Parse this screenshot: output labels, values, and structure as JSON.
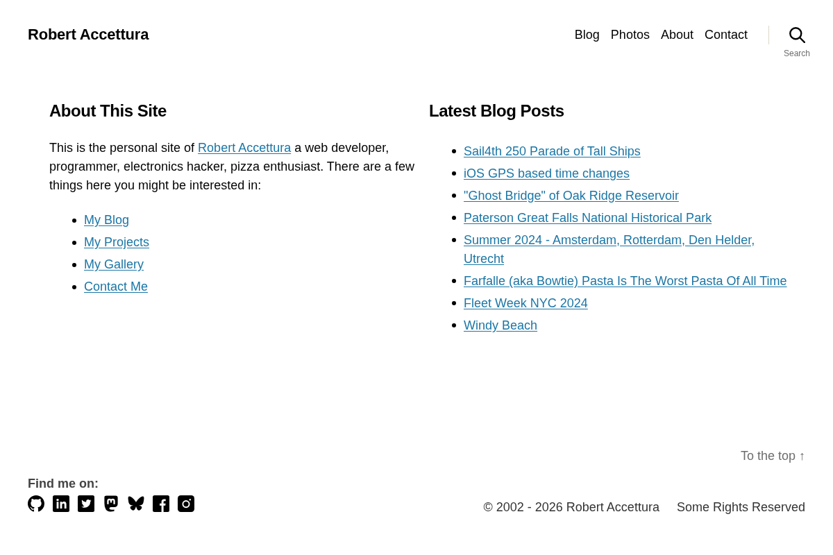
{
  "header": {
    "site_title": "Robert Accettura",
    "nav": [
      "Blog",
      "Photos",
      "About",
      "Contact"
    ],
    "search_label": "Search"
  },
  "about": {
    "heading": "About This Site",
    "intro": [
      {
        "kind": "text",
        "text": "This is the personal site of "
      },
      {
        "kind": "link",
        "text": "Robert Accettura"
      },
      {
        "kind": "text",
        "text": " a web developer, programmer, electronics hacker, pizza enthusiast. There are a few things here you might be interested in:"
      }
    ],
    "links": [
      "My Blog",
      "My Projects",
      "My Gallery",
      "Contact Me"
    ]
  },
  "latest_posts": {
    "heading": "Latest Blog Posts",
    "posts": [
      "Sail4th 250 Parade of Tall Ships",
      "iOS GPS based time changes",
      "\"Ghost Bridge\" of Oak Ridge Reservoir",
      "Paterson Great Falls National Historical Park",
      "Summer 2024 - Amsterdam, Rotterdam, Den Helder, Utrecht",
      "Farfalle (aka Bowtie) Pasta Is The Worst Pasta Of All Time",
      "Fleet Week NYC 2024",
      "Windy Beach"
    ]
  },
  "footer": {
    "to_top": "To the top ↑",
    "find_me": "Find me on:",
    "social": [
      {
        "kind": "github"
      },
      {
        "kind": "linkedin"
      },
      {
        "kind": "twitter"
      },
      {
        "kind": "mastodon"
      },
      {
        "kind": "bluesky"
      },
      {
        "kind": "facebook"
      },
      {
        "kind": "instagram"
      }
    ],
    "copyright": "© 2002 - 2026 Robert Accettura",
    "rights": "Some Rights Reserved"
  }
}
